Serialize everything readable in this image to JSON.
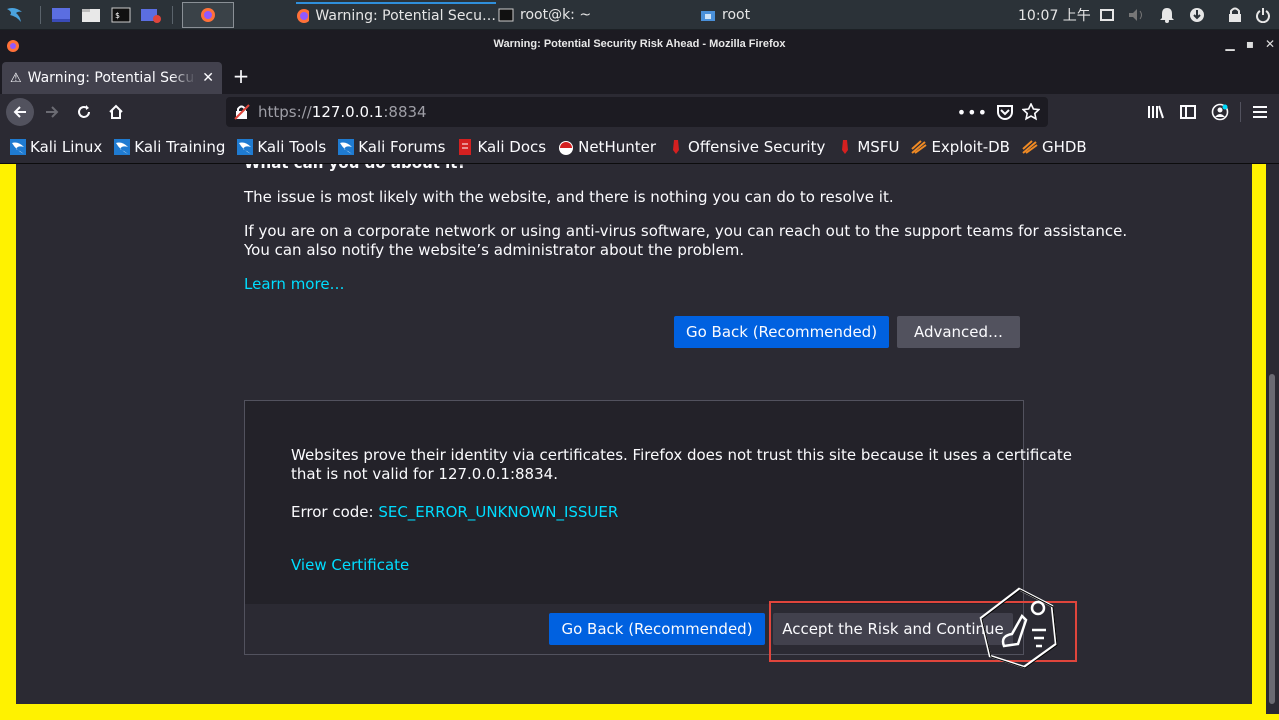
{
  "taskbar": {
    "tasks": [
      {
        "label": "Warning: Potential Secu…",
        "active": true
      },
      {
        "label": "root@k: ~",
        "active": false
      },
      {
        "label": "root",
        "active": false
      }
    ],
    "clock": "10:07 上午"
  },
  "window": {
    "title": "Warning: Potential Security Risk Ahead - Mozilla Firefox"
  },
  "tab": {
    "label": "Warning: Potential Security Risk Ahead"
  },
  "urlbar": {
    "scheme": "https://",
    "host": "127.0.0.1",
    "port": ":8834"
  },
  "bookmarks": [
    {
      "label": "Kali Linux",
      "icon": "kali-icon"
    },
    {
      "label": "Kali Training",
      "icon": "kali-icon"
    },
    {
      "label": "Kali Tools",
      "icon": "kali-icon"
    },
    {
      "label": "Kali Forums",
      "icon": "kali-icon"
    },
    {
      "label": "Kali Docs",
      "icon": "kali-docs-icon"
    },
    {
      "label": "NetHunter",
      "icon": "nethunter-icon"
    },
    {
      "label": "Offensive Security",
      "icon": "offsec-icon"
    },
    {
      "label": "MSFU",
      "icon": "offsec-icon"
    },
    {
      "label": "Exploit-DB",
      "icon": "exploitdb-icon"
    },
    {
      "label": "GHDB",
      "icon": "exploitdb-icon"
    }
  ],
  "page": {
    "what_heading": "What can you do about it?",
    "para1": "The issue is most likely with the website, and there is nothing you can do to resolve it.",
    "para2_line1": "If you are on a corporate network or using anti-virus software, you can reach out to the support teams for assistance.",
    "para2_line2": "You can also notify the website’s administrator about the problem.",
    "learn_more": "Learn more…",
    "go_back": "Go Back (Recommended)",
    "advanced": "Advanced…",
    "adv_line1": "Websites prove their identity via certificates. Firefox does not trust this site because it uses a certificate",
    "adv_line2": "that is not valid for 127.0.0.1:8834.",
    "error_code_label": "Error code: ",
    "error_code": "SEC_ERROR_UNKNOWN_ISSUER",
    "view_certificate": "View Certificate",
    "go_back_2": "Go Back (Recommended)",
    "accept": "Accept the Risk and Continue"
  },
  "colors": {
    "frame": "#fff200",
    "content_bg": "#2b2a33",
    "primary_button": "#0061e0",
    "link": "#00ddff",
    "highlight": "#e0453c"
  }
}
